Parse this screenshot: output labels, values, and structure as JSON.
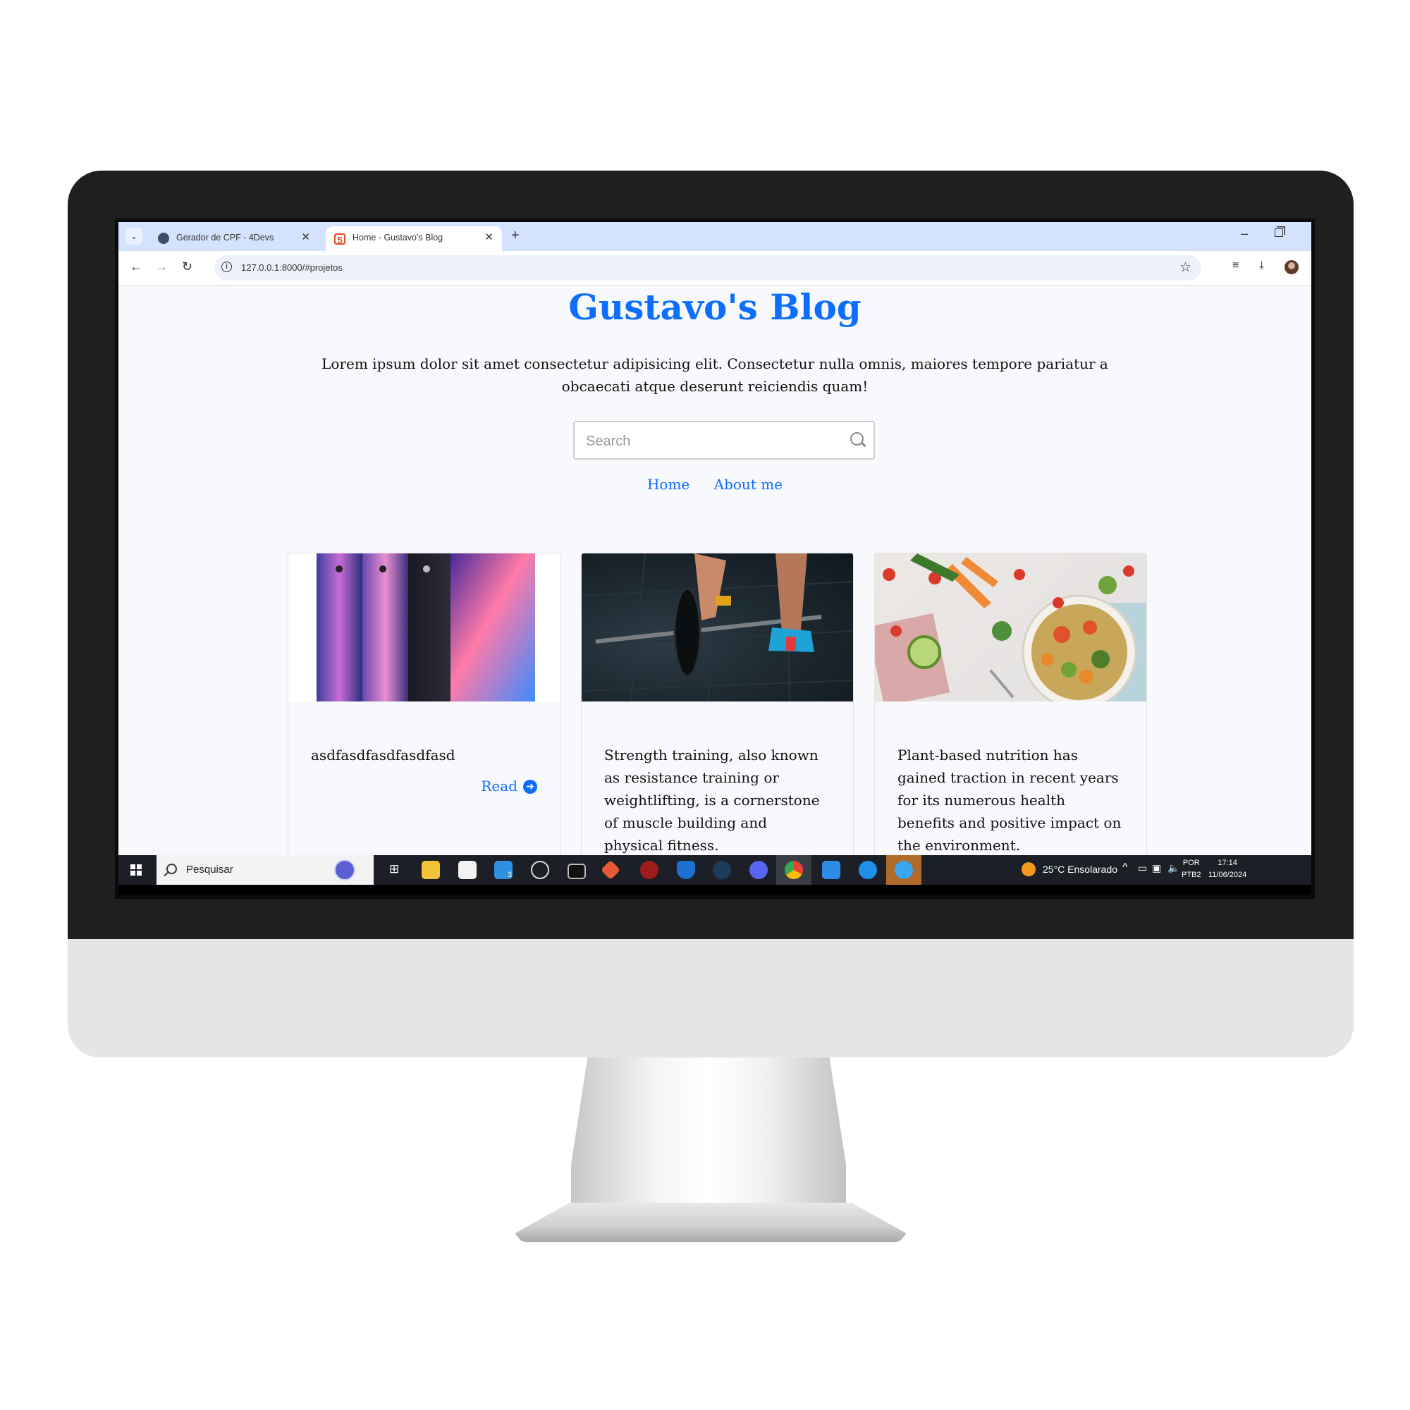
{
  "browser": {
    "tabs": [
      {
        "title": "Gerador de CPF - 4Devs",
        "active": false
      },
      {
        "title": "Home - Gustavo's Blog",
        "active": true
      }
    ],
    "url": "127.0.0.1:8000/#projetos"
  },
  "page": {
    "title": "Gustavo's Blog",
    "intro": "Lorem ipsum dolor sit amet consectetur adipisicing elit. Consectetur nulla omnis, maiores tempore pariatur a obcaecati atque deserunt reiciendis quam!",
    "search_placeholder": "Search",
    "nav": [
      "Home",
      "About me"
    ],
    "cards": [
      {
        "text": "asdfasdfasdfasdfasd",
        "link": "Read",
        "image": "phones-image"
      },
      {
        "text": "Strength training, also known as resistance training or weightlifting, is a cornerstone of muscle building and physical fitness.",
        "image": "barbell-image"
      },
      {
        "text": "Plant-based nutrition has gained traction in recent years for its numerous health benefits and positive impact on the environment.",
        "image": "salad-image"
      }
    ],
    "accent_color": "#0d6efd"
  },
  "taskbar": {
    "search_label": "Pesquisar",
    "mail_badge": "3",
    "weather": "25°C  Ensolarado",
    "lang_line1": "POR",
    "lang_line2": "PTB2",
    "time": "17:14",
    "date": "11/06/2024"
  }
}
